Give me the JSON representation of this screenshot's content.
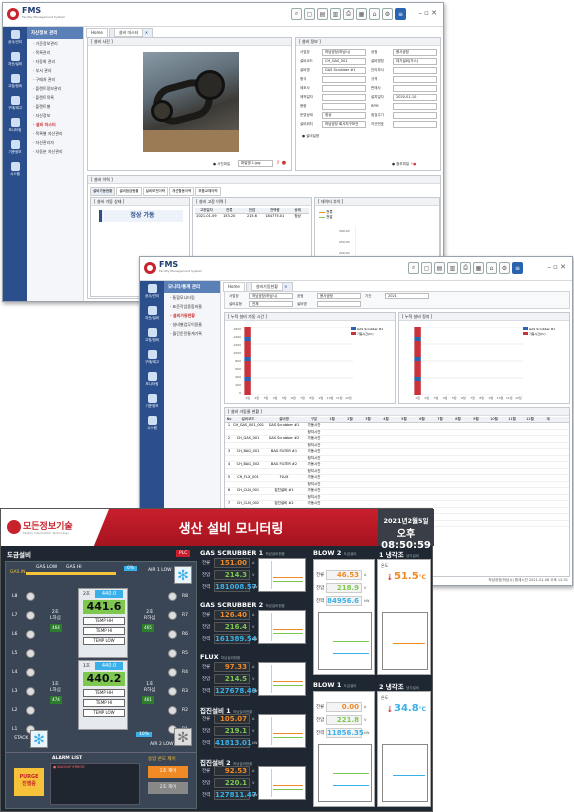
{
  "win1": {
    "brand": "FMS",
    "brand_sub": "Facility Management System",
    "tabs": [
      "Home",
      "설비 마스터"
    ],
    "sidebar": [
      "공사/관리",
      "자산/설비",
      "고장/정비",
      "구매/재고",
      "모니터링",
      "기준정보",
      "시스템"
    ],
    "menu_title": "자산정보 관리",
    "menu": [
      "· 기준정보관리",
      "· 목록관리",
      "· 자동화 관리",
      "· 부서 관리",
      "· 구매처 관리",
      "· 플랜트정보관리",
      "· 플랜트목록",
      "· 플랜트별",
      "· 자산정보",
      "· 설비 마스터",
      "· 목록별 자산관리",
      "· 자산관리자",
      "· 자동분 자산관리"
    ],
    "photo_title": "[ 설비 사진 ]",
    "info_title": "[ 설비 정보 ]",
    "fields": [
      {
        "l": "사업장",
        "v": "하남공장(하남시)"
      },
      {
        "l": "공정",
        "v": "용사공정"
      },
      {
        "l": "설비코드",
        "v": "CH_GAS_001"
      },
      {
        "l": "설비명칭",
        "v": "대기설비(가스)"
      },
      {
        "l": "설비명",
        "v": "GAS Scrubber #1"
      },
      {
        "l": "관리부서",
        "v": ""
      },
      {
        "l": "형식",
        "v": ""
      },
      {
        "l": "규격",
        "v": ""
      },
      {
        "l": "제조사",
        "v": ""
      },
      {
        "l": "판매사",
        "v": ""
      },
      {
        "l": "제작일자",
        "v": ""
      },
      {
        "l": "설치일자",
        "v": "2020-01-10"
      },
      {
        "l": "용량",
        "v": ""
      },
      {
        "l": "RPM",
        "v": ""
      },
      {
        "l": "운영상태",
        "v": "정상"
      },
      {
        "l": "점검주기",
        "v": ""
      },
      {
        "l": "설비위치",
        "v": "하남공장 회사지구보건"
      },
      {
        "l": "자산번호",
        "v": ""
      }
    ],
    "remark_label": "설비설명",
    "photo_path_label": "사진파일",
    "photo_path_value": "파일명 1.jpg",
    "attach_label": "첨부파일",
    "bottom_title": "[ 설비 이력 ]",
    "bottom_tabs": [
      "설비가동현황",
      "설비점검현황",
      "설비보전이력",
      "개선활동이력",
      "부품교체이력"
    ],
    "status_title": "[ 설비 가동 상태 ]",
    "status_badge": "정상 가동",
    "hist_title": "[ 설비 고장 이력 ]",
    "hist_headers": [
      "고장일자",
      "전류",
      "전압",
      "전력량",
      "상태"
    ],
    "hist_row": [
      "2021-01-09",
      "153.20",
      "215.6",
      "184775.01",
      "정상"
    ],
    "trend_title": "[ 데이터 추이 ]",
    "trend_legend": [
      "전류",
      "전압"
    ],
    "trend_ticks": [
      "300.00",
      "250.00",
      "200.00",
      "150.00",
      "100.00"
    ]
  },
  "win2": {
    "brand": "FMS",
    "brand_sub": "Facility Management System",
    "tabs": [
      "Home",
      "설비가동현황"
    ],
    "menu_title": "모니터/통계 관리",
    "menu": [
      "· 통합모니터링",
      "· 표준작업종합비율",
      "· 설비가동현황",
      "· 설비별업무이용율",
      "· 월간운전통계기록"
    ],
    "filters": [
      {
        "l": "사업장",
        "v": "하남공장(하남시)"
      },
      {
        "l": "공정",
        "v": "용사공정"
      },
      {
        "l": "기간",
        "v": "2021"
      },
      {
        "l": "설비유형",
        "v": "전체"
      },
      {
        "l": "설비명",
        "v": ""
      }
    ],
    "chart1_title": "[ 누적 설비 가동 시간 ]",
    "chart2_title": "[ 누적 설비 정지 ]",
    "legend": [
      "GAS Scrubber #1",
      "가동시간(hr)"
    ],
    "months": [
      "1월",
      "2월",
      "3월",
      "4월",
      "5월",
      "6월",
      "7월",
      "8월",
      "9월",
      "10월",
      "11월",
      "12월"
    ],
    "y_ticks": [
      "1600",
      "1400",
      "1200",
      "1000",
      "800",
      "600",
      "400",
      "200",
      "0"
    ],
    "table_title": "[ 설비 가동율 현황 ]",
    "table_headers": [
      "No",
      "설비코드",
      "설비명",
      "구분",
      "1월",
      "2월",
      "3월",
      "4월",
      "5월",
      "6월",
      "7월",
      "8월",
      "9월",
      "10월",
      "11월",
      "12월",
      "계"
    ],
    "rows": [
      [
        "1",
        "CH_GAS_001_001",
        "GAS Scrubber #1"
      ],
      [
        "2",
        "CH_GAS_001",
        "GAS Scrubber #2"
      ],
      [
        "3",
        "CH_BAG_001",
        "BAG FILTER #1"
      ],
      [
        "4",
        "CH_BAG_002",
        "BAG FILTER #2"
      ],
      [
        "5",
        "CH_FLX_001",
        "FLUX"
      ],
      [
        "6",
        "CH_CLN_001",
        "집진설비 #1"
      ],
      [
        "7",
        "CH_CLN_002",
        "집진설비 #2"
      ],
      [
        "8",
        "HNB-1",
        "BLOW"
      ]
    ],
    "row_labels": [
      "가동시간",
      "정지시간"
    ],
    "footer": "하남공장(하남시) 합계시간 2021-01-08 오후 12:31"
  },
  "board": {
    "logo": "모든정보기술",
    "logo_sub": "Modoo Information Technology",
    "title": "생산 설비 모니터링",
    "date": "2021년2월5일",
    "time": "오후 08:50:59",
    "left_title": "도금설비",
    "plc": "PLC",
    "gas_in": "GAS IN",
    "gas_low": "GAS LOW",
    "gas_hi": "GAS HI",
    "pct_top": "0%",
    "air1": "AIR 1 LOW",
    "stack": "STACK",
    "pct_bot": "10%",
    "air2": "AIR 2 LOW",
    "left_levels": [
      "L8",
      "L7",
      "L6",
      "L5",
      "L4",
      "L3",
      "L2",
      "L1"
    ],
    "right_levels": [
      "R8",
      "R7",
      "R6",
      "R5",
      "R4",
      "R3",
      "R2",
      "R1"
    ],
    "tank2": {
      "title": "2호",
      "sp": "440.0",
      "pv": "441.6",
      "btns": [
        "TEMP HH",
        "TEMP HI",
        "TEMP LOW"
      ],
      "l": "2호\nL하심",
      "r": "2호\nR하심",
      "lv": "464",
      "rv": "465"
    },
    "tank1": {
      "title": "1호",
      "sp": "440.0",
      "pv": "440.2",
      "btns": [
        "TEMP HH",
        "TEMP HI",
        "TEMP LOW"
      ],
      "l": "1호\nL하심",
      "r": "1호\nR하심",
      "lv": "474",
      "rv": "461"
    },
    "alarm_title": "ALARM LIST",
    "alarm_item": "BACKUP ERROR",
    "purge": "PURGE\n진행중",
    "ctrl_title": "승압 온도 제어",
    "ctrl1": "1호 제어",
    "ctrl2": "2호 제어",
    "units": [
      {
        "name": "GAS SCRUBBER 1",
        "sub": "하남설비현황",
        "a": "151.00",
        "v": "214.3",
        "p": "181008.57"
      },
      {
        "name": "GAS SCRUBBER 2",
        "sub": "하남설비현황",
        "a": "126.40",
        "v": "216.4",
        "p": "161389.54"
      },
      {
        "name": "FLUX",
        "sub": "하남설비현황",
        "a": "97.33",
        "v": "214.5",
        "p": "127678.49"
      },
      {
        "name": "집진설비 1",
        "sub": "하남설비현황",
        "a": "105.07",
        "v": "219.1",
        "p": "41813.01"
      },
      {
        "name": "집진설비 2",
        "sub": "하남설비현황",
        "a": "92.53",
        "v": "220.1",
        "p": "127811.47"
      }
    ],
    "labels": {
      "a": "전류",
      "v": "전압",
      "p": "전력"
    },
    "unit_a": "A",
    "unit_v": "V",
    "unit_p": "kW",
    "blow2": {
      "name": "BLOW 2",
      "sub": "도금설비",
      "a": "46.53",
      "v": "218.9",
      "p": "84956.6"
    },
    "blow1": {
      "name": "BLOW 1",
      "sub": "도금설비",
      "a": "0.00",
      "v": "221.8",
      "p": "11856.35"
    },
    "cool1": {
      "name": "1 냉각조",
      "sub": "냉각설비",
      "lbl": "온도",
      "t": "51.5",
      "u": "℃"
    },
    "cool2": {
      "name": "2 냉각조",
      "sub": "냉각설비",
      "lbl": "온도",
      "t": "34.8",
      "u": "℃"
    },
    "colors": {
      "red": "#c91f2c",
      "orange": "#f08a24",
      "green": "#7ec850",
      "cyan": "#3ab0e8"
    }
  }
}
